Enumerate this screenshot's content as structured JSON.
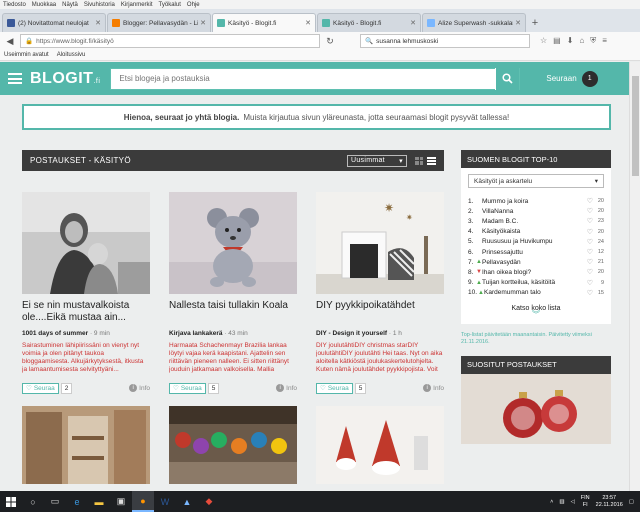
{
  "menu": [
    "Tiedosto",
    "Muokkaa",
    "Näytä",
    "Sivuhistoria",
    "Kirjanmerkit",
    "Työkalut",
    "Ohje"
  ],
  "tabs": [
    {
      "label": "(2) Novitattomat neulojat",
      "color": "#3b5998",
      "active": false
    },
    {
      "label": "Blogger: Pellavasydän - Lii...",
      "color": "#f57d00",
      "active": false
    },
    {
      "label": "Käsityö - Blogit.fi",
      "color": "#54b7aa",
      "active": true
    },
    {
      "label": "Käsityö - Blogit.fi",
      "color": "#54b7aa",
      "active": false
    },
    {
      "label": "Alize Superwash -sukkalan...",
      "color": "#7ab7ff",
      "active": false
    }
  ],
  "nav": {
    "url": "https://www.blogit.fi/käsityö",
    "search_value": "susanna lehmuskoski"
  },
  "bookmarks": [
    "Useimmin avatut",
    "Aloitussivu"
  ],
  "header": {
    "logo": "BLOGIT",
    "logo_suffix": ".fi",
    "search_placeholder": "Etsi blogeja ja postauksia",
    "follow_label": "Seuraan",
    "follow_count": "1"
  },
  "notice": {
    "bold": "Hienoa, seuraat jo yhtä blogia.",
    "text": "Muista kirjautua sivun yläreunasta, jotta seuraamasi blogit pysyvät tallessa!"
  },
  "posts_panel": {
    "title": "POSTAUKSET - KÄSITYÖ",
    "sort": "Uusimmat"
  },
  "posts": [
    {
      "title": "Ei se nin mustavalkoista ole....Eikä mustaa ain...",
      "blog": "1001 days of summer",
      "time": "· 9 min",
      "excerpt": "Sairastuminen lähipiirissäni on vienyt nyt voimia ja olen pitänyt taukoa bloggaamisesta. Alkujärkytyksestä, itkusta ja lamaantumisesta selvityttyäni...",
      "follow_label": "Seuraa",
      "followers": "2",
      "info_label": "Info"
    },
    {
      "title": "Nallesta taisi tullakin Koala",
      "blog": "Kirjava lankakerä",
      "time": "· 43 min",
      "excerpt": "Harmaata Schachenmayr Brazilia lankaa löytyi vajaa kerä kaapistani. Ajattelin sen riittävän pieneen nalleen. Ei sitten riittänyt jouduin jatkamaan valkoisella. Mallia katselin SK-lehden...",
      "follow_label": "Seuraa",
      "followers": "5",
      "info_label": "Info"
    },
    {
      "title": "DIY pyykkipoikatähdet",
      "blog": "DIY - Design it yourself",
      "time": "· 1 h",
      "excerpt": "DIY joulutähtiDIY christmas starDIY joulutähtiDIY joulutähti Hei taas. Nyt on aika aloitella kätkiöstä joulukaskertelutohjelta. Kuten nämä joulutähdet pyykkipojista. Voit käyttää ihan vain kuusia...",
      "follow_label": "Seuraa",
      "followers": "5",
      "info_label": "Info"
    }
  ],
  "top_panel": {
    "title": "SUOMEN BLOGIT TOP-10",
    "category": "Käsityöt ja askartelu",
    "items": [
      {
        "num": "1.",
        "arrow": "",
        "name": "Mummo ja koira",
        "count": "20"
      },
      {
        "num": "2.",
        "arrow": "",
        "name": "VillaNanna",
        "count": "20"
      },
      {
        "num": "3.",
        "arrow": "",
        "name": "Madam B.C.",
        "count": "23"
      },
      {
        "num": "4.",
        "arrow": "",
        "name": "Käsityökaista",
        "count": "20"
      },
      {
        "num": "5.",
        "arrow": "",
        "name": "Ruususuu ja Huvikumpu",
        "count": "24"
      },
      {
        "num": "6.",
        "arrow": "",
        "name": "Prinsessajuttu",
        "count": "12"
      },
      {
        "num": "7.",
        "arrow": "▲",
        "name": "Pellavasydän",
        "count": "21"
      },
      {
        "num": "8.",
        "arrow": "▼",
        "name": "Ihan oikea blogi?",
        "count": "20"
      },
      {
        "num": "9.",
        "arrow": "▲",
        "name": "Tuijan kortteilua, käsitöitä",
        "count": "9"
      },
      {
        "num": "10.",
        "arrow": "▲",
        "name": "Kardemumman talo",
        "count": "15"
      }
    ],
    "show_all": "Katso koko lista",
    "note": "Top-listat päivitetään maanantaisin. Päivitetty viimeksi 21.11.2016."
  },
  "popular_panel": {
    "title": "SUOSITUT POSTAUKSET"
  },
  "taskbar": {
    "lang": "FIN",
    "lang2": "FI",
    "time": "23:57",
    "date": "22.11.2016"
  },
  "colors": {
    "accent": "#54b7aa",
    "dark": "#3b3b3b",
    "excerpt": "#cc3333"
  }
}
